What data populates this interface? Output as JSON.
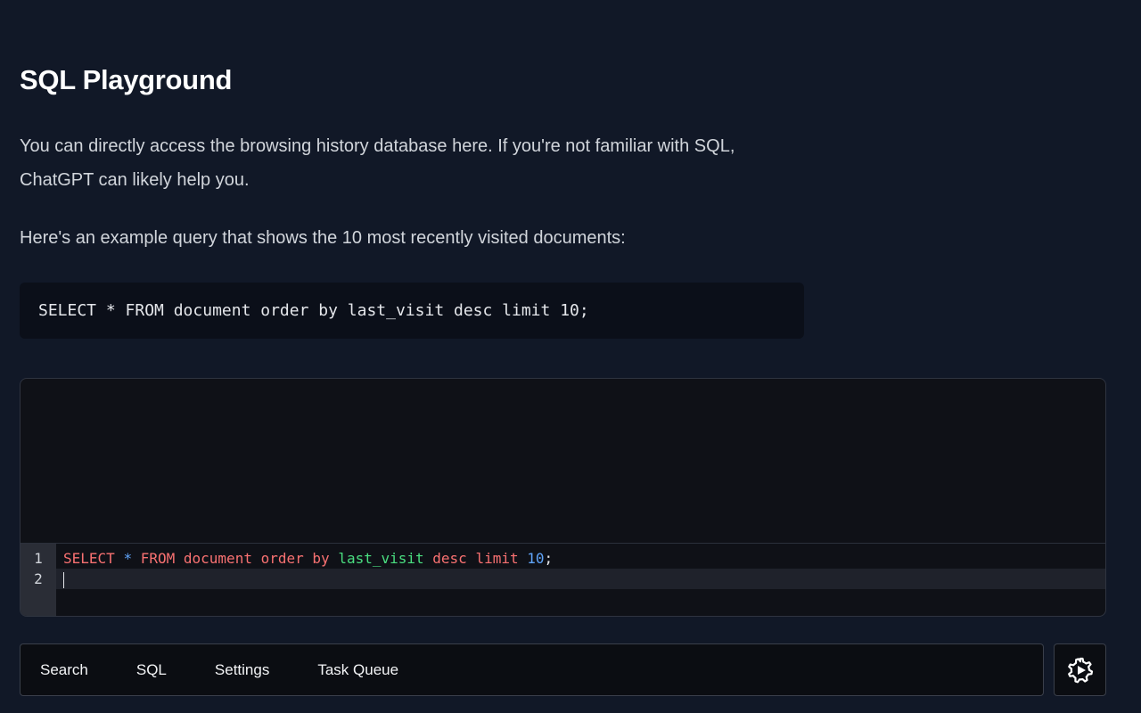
{
  "page": {
    "title": "SQL Playground",
    "intro": "You can directly access the browsing history database here. If you're not familiar with SQL, ChatGPT can likely help you.",
    "example_intro": "Here's an example query that shows the 10 most recently visited documents:",
    "example_query": "SELECT * FROM document order by last_visit desc limit 10;"
  },
  "editor": {
    "lines": [
      {
        "number": "1",
        "tokens": [
          {
            "text": "SELECT",
            "type": "kw"
          },
          {
            "text": " ",
            "type": "punc"
          },
          {
            "text": "*",
            "type": "op"
          },
          {
            "text": " ",
            "type": "punc"
          },
          {
            "text": "FROM",
            "type": "kw"
          },
          {
            "text": " ",
            "type": "punc"
          },
          {
            "text": "document",
            "type": "id"
          },
          {
            "text": " ",
            "type": "punc"
          },
          {
            "text": "order",
            "type": "kw"
          },
          {
            "text": " ",
            "type": "punc"
          },
          {
            "text": "by",
            "type": "kw"
          },
          {
            "text": " ",
            "type": "punc"
          },
          {
            "text": "last_visit",
            "type": "col"
          },
          {
            "text": " ",
            "type": "punc"
          },
          {
            "text": "desc",
            "type": "kw"
          },
          {
            "text": " ",
            "type": "punc"
          },
          {
            "text": "limit",
            "type": "kw"
          },
          {
            "text": " ",
            "type": "punc"
          },
          {
            "text": "10",
            "type": "num"
          },
          {
            "text": ";",
            "type": "punc"
          }
        ]
      },
      {
        "number": "2",
        "tokens": []
      }
    ]
  },
  "nav": {
    "items": [
      "Search",
      "SQL",
      "Settings",
      "Task Queue"
    ],
    "settings_icon": "gear-play-icon"
  }
}
